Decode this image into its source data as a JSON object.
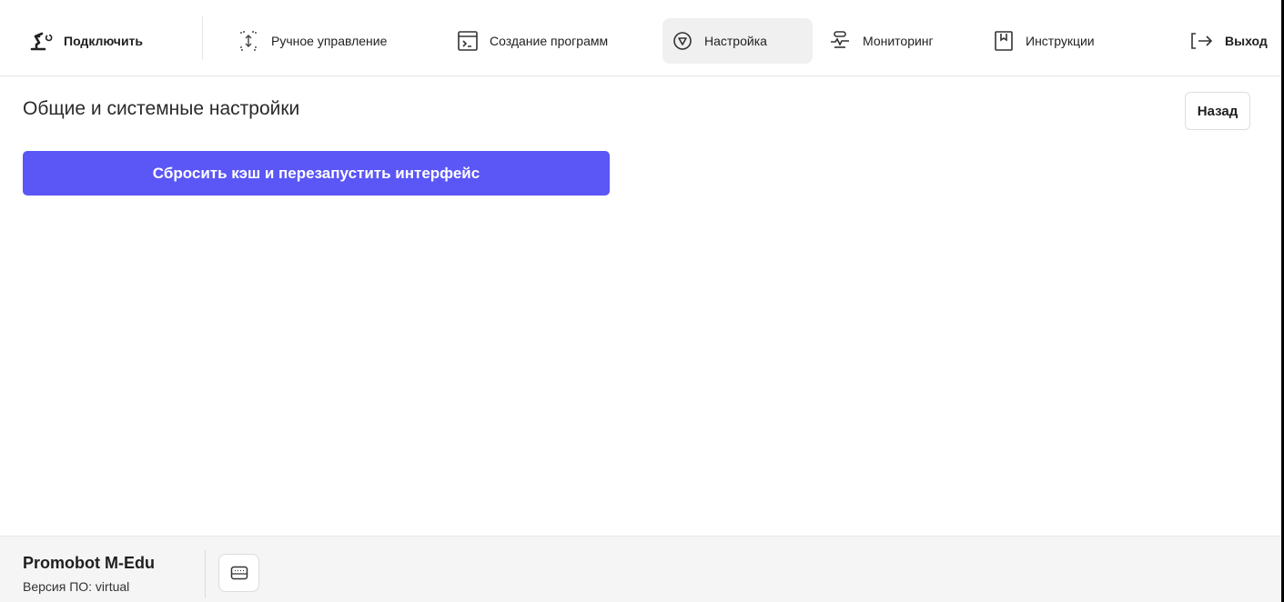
{
  "nav": {
    "connect": {
      "label": "Подключить",
      "icon": "robot-arm-icon"
    },
    "manual": {
      "label": "Ручное управление",
      "icon": "move-control-icon"
    },
    "programs": {
      "label": "Создание программ",
      "icon": "terminal-icon"
    },
    "settings": {
      "label": "Настройка",
      "icon": "settings-icon",
      "active": true
    },
    "monitoring": {
      "label": "Мониторинг",
      "icon": "monitoring-icon"
    },
    "instructions": {
      "label": "Инструкции",
      "icon": "bookmark-icon"
    },
    "logout": {
      "label": "Выход",
      "icon": "logout-icon"
    }
  },
  "main": {
    "title": "Общие и системные настройки",
    "back_label": "Назад",
    "reset_label": "Сбросить кэш и перезапустить интерфейс"
  },
  "footer": {
    "device_name": "Promobot M-Edu",
    "version": "Версия ПО: virtual",
    "keyboard_icon": "keyboard-icon"
  },
  "colors": {
    "accent": "#5b56f6",
    "active_nav_bg": "#f0f0f0",
    "footer_bg": "#f5f5f5"
  }
}
